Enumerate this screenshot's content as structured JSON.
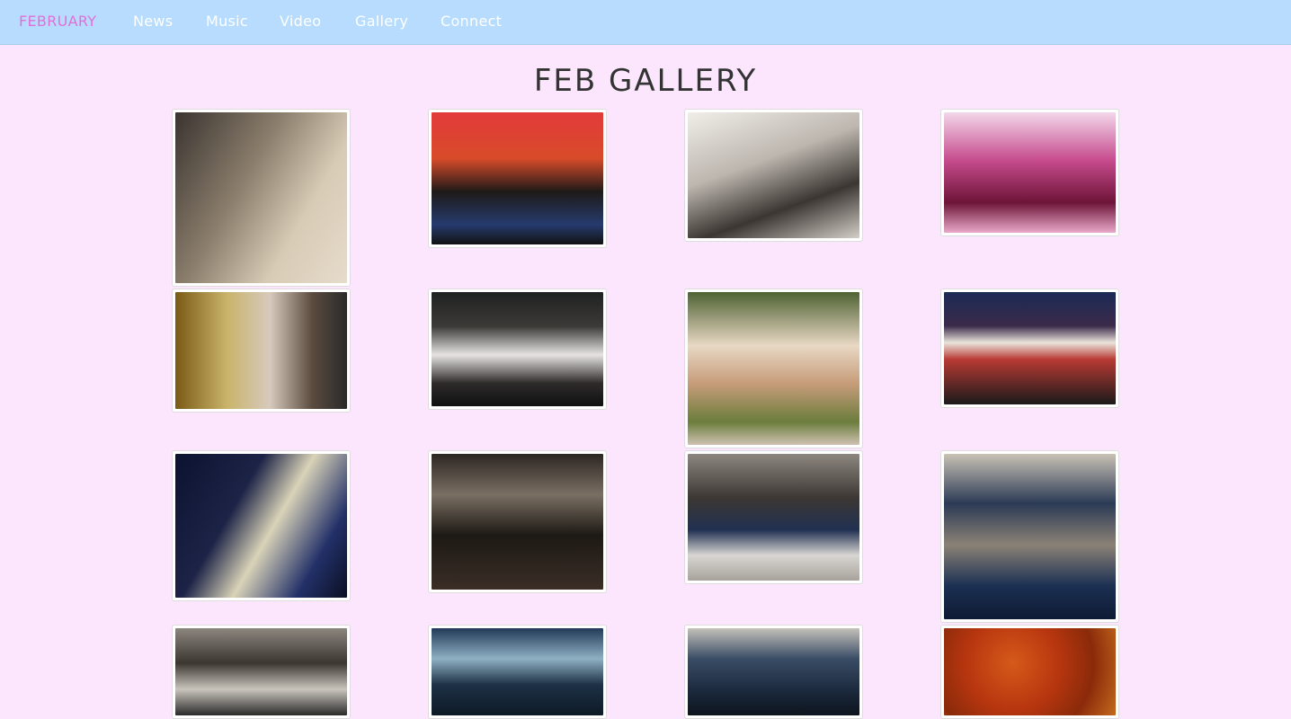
{
  "nav": {
    "brand": "FEBRUARY",
    "items": [
      "News",
      "Music",
      "Video",
      "Gallery",
      "Connect"
    ]
  },
  "page": {
    "title": "FEB GALLERY"
  },
  "colors": {
    "background": "#fbe6fd",
    "navbar": "#b7dcfd",
    "brand": "#e070d8"
  },
  "gallery": [
    {
      "name": "photo-band-sepia-portrait",
      "bg": "linear-gradient(120deg,#3a3430 0%,#8b7e6c 40%,#d8cbb6 70%,#e6dccb 100%)"
    },
    {
      "name": "photo-band-red-ceiling",
      "bg": "linear-gradient(180deg,#e23a3a 0%,#d84b2a 35%,#1e1a18 60%,#263b6e 85%,#111 100%)"
    },
    {
      "name": "photo-band-bw-leaning",
      "bg": "linear-gradient(160deg,#f1eee9 0%,#bcb6ae 40%,#3b3632 70%,#d3cec7 100%)"
    },
    {
      "name": "photo-band-magenta-ferris",
      "bg": "linear-gradient(180deg,#f3d7ea 0%,#c64b8d 40%,#6d1437 75%,#e9a9c9 100%)"
    },
    {
      "name": "photo-band-backstage",
      "bg": "linear-gradient(90deg,#7a5a14 0%,#c9b36a 30%,#d7cabc 55%,#5a4a3e 80%,#2a2a2a 100%)"
    },
    {
      "name": "photo-crowd-club",
      "bg": "linear-gradient(180deg,#1f2121 0%,#3c3a37 30%,#e6e4e2 55%,#2d2a2a 80%,#101010 100%)"
    },
    {
      "name": "photo-band-van",
      "bg": "linear-gradient(180deg,#4f6233 0%,#e8d8c4 35%,#c79c7a 60%,#6b7d3c 85%,#cfc2b2 100%)"
    },
    {
      "name": "photo-theater-marquee",
      "bg": "linear-gradient(180deg,#1b2a55 0%,#3b2a4a 30%,#e9e4db 45%,#b83a34 60%,#1a1a1a 100%)"
    },
    {
      "name": "photo-stage-dancer",
      "bg": "linear-gradient(120deg,#0c1230 0%,#1c2346 35%,#d9d3b8 55%,#223068 80%,#0b0f22 100%)"
    },
    {
      "name": "photo-stage-singer",
      "bg": "linear-gradient(180deg,#2c2622 0%,#7a6f63 30%,#1d1914 60%,#3a2e26 100%)"
    },
    {
      "name": "photo-stage-drums",
      "bg": "linear-gradient(180deg,#8d8780 0%,#3c3733 35%,#213052 60%,#d8d6d2 80%,#a8a29b 100%)"
    },
    {
      "name": "photo-stage-guitarists",
      "bg": "linear-gradient(180deg,#c9c2b5 0%,#2b3a55 30%,#8b8276 55%,#1b2f52 80%,#0e1a33 100%)"
    },
    {
      "name": "photo-stage-guitarist-solo",
      "bg": "linear-gradient(180deg,#8b867e 0%,#3b3630 40%,#c9c4bc 70%,#2a2a2a 100%)"
    },
    {
      "name": "photo-stage-flute",
      "bg": "linear-gradient(180deg,#223a58 0%,#8fb0c3 35%,#1d3045 65%,#0d1a26 100%)"
    },
    {
      "name": "photo-stage-saxophone",
      "bg": "linear-gradient(180deg,#c5c1ba 0%,#3a4d66 35%,#1c2b3e 70%,#0d141e 100%)"
    },
    {
      "name": "photo-orange-texture",
      "bg": "radial-gradient(circle at 40% 40%,#d55a1a 0%,#b8360f 40%,#8a2a0a 70%,#c46a1d 100%)"
    }
  ]
}
